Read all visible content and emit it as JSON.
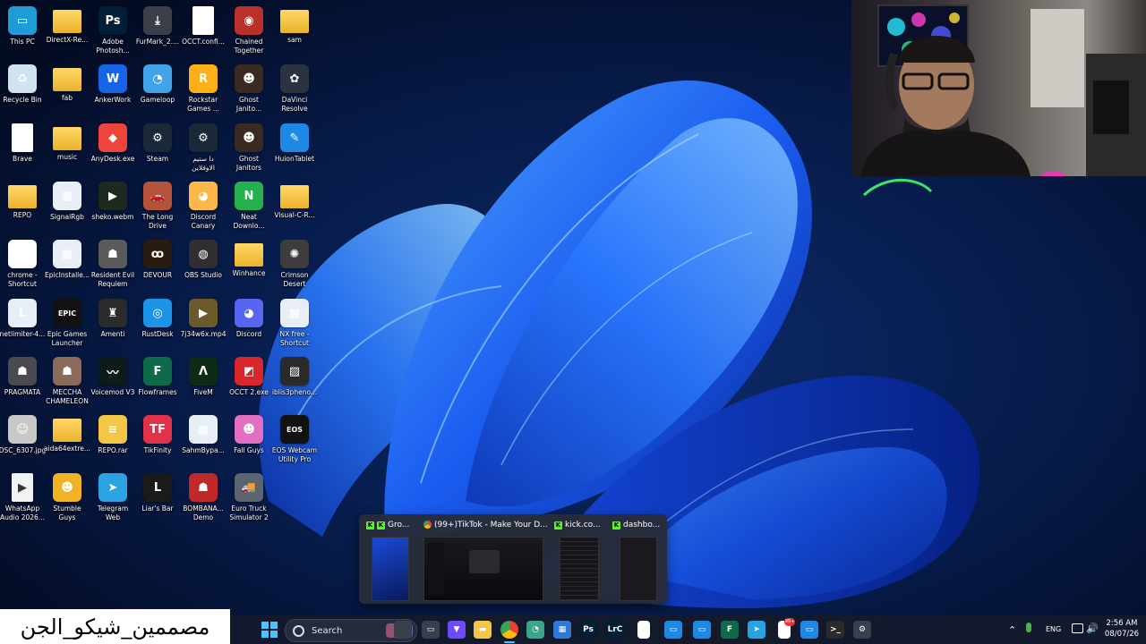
{
  "desktop": {
    "icons": [
      {
        "label": "This PC",
        "icon": "monitor-icon",
        "color": "#1f9bd8",
        "glyph": "▭"
      },
      {
        "label": "DirectX-Re...",
        "icon": "folder-icon",
        "color": "#f4c646",
        "glyph": ""
      },
      {
        "label": "Adobe\nPhotosh...",
        "icon": "photoshop-icon",
        "color": "#001e36",
        "glyph": "Ps"
      },
      {
        "label": "FurMark_2....",
        "icon": "download-icon",
        "color": "#3a3f4a",
        "glyph": "⤓"
      },
      {
        "label": "OCCT.confi...",
        "icon": "file-icon",
        "color": "#ffffff",
        "glyph": ""
      },
      {
        "label": "Chained\nTogether",
        "icon": "chained-together-icon",
        "color": "#b8322b",
        "glyph": "◉"
      },
      {
        "label": "sam",
        "icon": "folder-icon",
        "color": "#f4c646",
        "glyph": ""
      },
      {
        "label": "Recycle Bin",
        "icon": "recycle-bin-icon",
        "color": "#cfe3f1",
        "glyph": "♻"
      },
      {
        "label": "fab",
        "icon": "folder-icon",
        "color": "#f4c646",
        "glyph": ""
      },
      {
        "label": "AnkerWork",
        "icon": "ankerwork-icon",
        "color": "#1764e8",
        "glyph": "W"
      },
      {
        "label": "Gameloop",
        "icon": "gameloop-icon",
        "color": "#42a4e8",
        "glyph": "◔"
      },
      {
        "label": "Rockstar\nGames ...",
        "icon": "rockstar-icon",
        "color": "#fcaf17",
        "glyph": "R"
      },
      {
        "label": "Ghost\nJanito...",
        "icon": "ghost-janitors-icon",
        "color": "#3a2a22",
        "glyph": "☻"
      },
      {
        "label": "DaVinci\nResolve",
        "icon": "davinci-resolve-icon",
        "color": "#2b3340",
        "glyph": "✿"
      },
      {
        "label": "Brave",
        "icon": "file-icon",
        "color": "#ffffff",
        "glyph": ""
      },
      {
        "label": "music",
        "icon": "folder-icon",
        "color": "#f4c646",
        "glyph": ""
      },
      {
        "label": "AnyDesk.exe",
        "icon": "anydesk-icon",
        "color": "#ef443b",
        "glyph": "◆"
      },
      {
        "label": "Steam",
        "icon": "steam-icon",
        "color": "#1b2838",
        "glyph": "⚙"
      },
      {
        "label": "دا ستيم\nالاوفلاين",
        "icon": "steam-icon",
        "color": "#1b2838",
        "glyph": "⚙"
      },
      {
        "label": "Ghost\nJanitors",
        "icon": "ghost-janitors-icon",
        "color": "#3a2a22",
        "glyph": "☻"
      },
      {
        "label": "HuionTablet",
        "icon": "huion-tablet-icon",
        "color": "#1e88e5",
        "glyph": "✎"
      },
      {
        "label": "REPO",
        "icon": "folder-icon",
        "color": "#f4c646",
        "glyph": ""
      },
      {
        "label": "SignalRgb",
        "icon": "signalrgb-icon",
        "color": "#e8eef5",
        "glyph": "▦"
      },
      {
        "label": "sheko.webm",
        "icon": "video-file-icon",
        "color": "#1f2a1f",
        "glyph": "▶"
      },
      {
        "label": "The Long\nDrive",
        "icon": "the-long-drive-icon",
        "color": "#b5533a",
        "glyph": "🚗"
      },
      {
        "label": "Discord\nCanary",
        "icon": "discord-canary-icon",
        "color": "#fbb848",
        "glyph": "◕"
      },
      {
        "label": "Neat\nDownlo...",
        "icon": "neat-download-icon",
        "color": "#22b14c",
        "glyph": "N"
      },
      {
        "label": "Visual-C-R...",
        "icon": "folder-icon",
        "color": "#f4c646",
        "glyph": ""
      },
      {
        "label": "chrome -\nShortcut",
        "icon": "chrome-icon",
        "color": "#ffffff",
        "glyph": "◉"
      },
      {
        "label": "EpicInstalle...",
        "icon": "installer-icon",
        "color": "#e8eef5",
        "glyph": "▦"
      },
      {
        "label": "Resident Evil\nRequiem",
        "icon": "resident-evil-icon",
        "color": "#5a5a5a",
        "glyph": "☗"
      },
      {
        "label": "DEVOUR",
        "icon": "devour-icon",
        "color": "#2a1a10",
        "glyph": "ꝏ"
      },
      {
        "label": "OBS Studio",
        "icon": "obs-icon",
        "color": "#302e31",
        "glyph": "◍"
      },
      {
        "label": "Winhance",
        "icon": "folder-icon",
        "color": "#f4c646",
        "glyph": ""
      },
      {
        "label": "Crimson\nDesert",
        "icon": "crimson-desert-icon",
        "color": "#3d3d3d",
        "glyph": "✺"
      },
      {
        "label": "netlimiter-4...",
        "icon": "netlimiter-icon",
        "color": "#e8eef5",
        "glyph": "L"
      },
      {
        "label": "Epic Games\nLauncher",
        "icon": "epic-games-icon",
        "color": "#111111",
        "glyph": "EPIC"
      },
      {
        "label": "Amenti",
        "icon": "amenti-icon",
        "color": "#2b2b2b",
        "glyph": "♜"
      },
      {
        "label": "RustDesk",
        "icon": "rustdesk-icon",
        "color": "#1a93e8",
        "glyph": "◎"
      },
      {
        "label": "7j34w6x.mp4",
        "icon": "video-file-icon",
        "color": "#6b5a2a",
        "glyph": "▶"
      },
      {
        "label": "Discord",
        "icon": "discord-icon",
        "color": "#5865f2",
        "glyph": "◕"
      },
      {
        "label": "NX free -\nShortcut",
        "icon": "installer-icon",
        "color": "#e8eef5",
        "glyph": "▦"
      },
      {
        "label": "PRAGMATA",
        "icon": "pragmata-icon",
        "color": "#4a4a52",
        "glyph": "☗"
      },
      {
        "label": "MECCHA\nCHAMELEON",
        "icon": "meccha-chameleon-icon",
        "color": "#8a6a5a",
        "glyph": "☗"
      },
      {
        "label": "Voicemod V3",
        "icon": "voicemod-icon",
        "color": "#0c1a1a",
        "glyph": "〰"
      },
      {
        "label": "Flowframes",
        "icon": "flowframes-icon",
        "color": "#0e6b4a",
        "glyph": "F"
      },
      {
        "label": "FiveM",
        "icon": "fivem-icon",
        "color": "#0f2b15",
        "glyph": "Λ"
      },
      {
        "label": "OCCT 2.exe",
        "icon": "occt-icon",
        "color": "#d8262a",
        "glyph": "◩"
      },
      {
        "label": "iblis3pheno...",
        "icon": "image-file-icon",
        "color": "#2a2a2a",
        "glyph": "▨"
      },
      {
        "label": "DSC_6307.jpg",
        "icon": "image-file-icon",
        "color": "#c8c8c8",
        "glyph": "☺"
      },
      {
        "label": "aida64extre...",
        "icon": "folder-icon",
        "color": "#f4c646",
        "glyph": ""
      },
      {
        "label": "REPO.rar",
        "icon": "archive-icon",
        "color": "#f4c646",
        "glyph": "≡"
      },
      {
        "label": "TikFinity",
        "icon": "tikfinity-icon",
        "color": "#e0334a",
        "glyph": "TF"
      },
      {
        "label": "SahmBypa...",
        "icon": "installer-icon",
        "color": "#e8eef5",
        "glyph": "▦"
      },
      {
        "label": "Fall Guys",
        "icon": "fall-guys-icon",
        "color": "#e26fc1",
        "glyph": "☻"
      },
      {
        "label": "EOS Webcam\nUtility Pro",
        "icon": "eos-webcam-icon",
        "color": "#111111",
        "glyph": "EOS"
      },
      {
        "label": "WhatsApp\nAudio 2026...",
        "icon": "audio-file-icon",
        "color": "#f2f2f2",
        "glyph": "▶"
      },
      {
        "label": "Stumble\nGuys",
        "icon": "stumble-guys-icon",
        "color": "#f0b323",
        "glyph": "☻"
      },
      {
        "label": "Telegram\nWeb",
        "icon": "telegram-icon",
        "color": "#2aa3e3",
        "glyph": "➤"
      },
      {
        "label": "Liar's Bar",
        "icon": "liars-bar-icon",
        "color": "#1a1a1a",
        "glyph": "L"
      },
      {
        "label": "BOMBANA...\nDemo",
        "icon": "bombana-icon",
        "color": "#c0282a",
        "glyph": "☗"
      },
      {
        "label": "Euro Truck\nSimulator 2",
        "icon": "euro-truck-icon",
        "color": "#5b6570",
        "glyph": "🚚"
      }
    ]
  },
  "overlay": {
    "arabic_text": "مصممين_شيكو_الجن"
  },
  "taskbar": {
    "search_label": "Search",
    "language": "ENG",
    "time": "2:56 AM",
    "date": "08/07/26",
    "notification_badge": "99+",
    "apps": [
      {
        "name": "widgets-icon",
        "color": "#3b3f4d",
        "glyph": ""
      },
      {
        "name": "task-view-icon",
        "color": "#3b3f4d",
        "glyph": "▭"
      },
      {
        "name": "proton-vpn-icon",
        "color": "#6d4aff",
        "glyph": "▼"
      },
      {
        "name": "file-explorer-icon",
        "color": "#f4c646",
        "glyph": "▬"
      },
      {
        "name": "chrome-icon",
        "color": "#dcdcdc",
        "glyph": "◉"
      },
      {
        "name": "gameloop-icon",
        "color": "#3aa58f",
        "glyph": "◔"
      },
      {
        "name": "microsoft-store-icon",
        "color": "#2e78d6",
        "glyph": "▦"
      },
      {
        "name": "photoshop-icon",
        "color": "#001e36",
        "glyph": "Ps"
      },
      {
        "name": "lightroom-icon",
        "color": "#001e36",
        "glyph": "LrC"
      },
      {
        "name": "notepad-icon",
        "color": "#ffffff",
        "glyph": ""
      },
      {
        "name": "app-window-icon",
        "color": "#1e88e5",
        "glyph": "▭"
      },
      {
        "name": "app-window-icon",
        "color": "#1e88e5",
        "glyph": "▭"
      },
      {
        "name": "flowframes-icon",
        "color": "#0e6b4a",
        "glyph": "F"
      },
      {
        "name": "telegram-icon",
        "color": "#2aa3e3",
        "glyph": "➤"
      },
      {
        "name": "document-icon",
        "color": "#ffffff",
        "glyph": ""
      },
      {
        "name": "app-window-icon",
        "color": "#1e88e5",
        "glyph": "▭"
      },
      {
        "name": "terminal-icon",
        "color": "#2b2b2b",
        "glyph": ">_"
      },
      {
        "name": "settings-icon",
        "color": "#3b3f4d",
        "glyph": "⚙"
      }
    ]
  },
  "preview": {
    "tabs": [
      {
        "title": "Gro...",
        "icon": "kick-icon"
      },
      {
        "title": "(99+)TikTok - Make Your D...",
        "icon": "chrome-icon"
      },
      {
        "title": "kick.co...",
        "icon": "kick-icon"
      },
      {
        "title": "dashbo...",
        "icon": "kick-icon"
      }
    ]
  }
}
